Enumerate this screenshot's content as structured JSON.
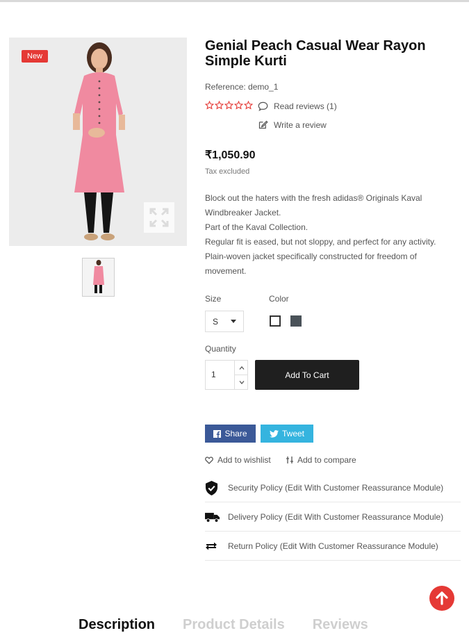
{
  "product": {
    "badge": "New",
    "title": "Genial Peach Casual Wear Rayon Simple Kurti",
    "reference": "Reference: demo_1",
    "rating_stars": 5,
    "read_reviews": "Read reviews (1)",
    "write_review": "Write a review",
    "price": "₹1,050.90",
    "tax_note": "Tax excluded",
    "description": [
      "Block out the haters with the fresh adidas® Originals Kaval Windbreaker Jacket.",
      "Part of the Kaval Collection.",
      "Regular fit is eased, but not sloppy, and perfect for any activity.",
      "Plain-woven jacket specifically constructed for freedom of movement."
    ]
  },
  "options": {
    "size_label": "Size",
    "size_value": "S",
    "color_label": "Color",
    "colors": [
      "#ffffff",
      "#4a5259"
    ]
  },
  "purchase": {
    "quantity_label": "Quantity",
    "quantity_value": "1",
    "add_to_cart": "Add To Cart"
  },
  "social": {
    "share": "Share",
    "tweet": "Tweet",
    "share_color": "#3b5998",
    "tweet_color": "#35b4df"
  },
  "actions": {
    "wishlist": "Add to wishlist",
    "compare": "Add to compare"
  },
  "reassurance": [
    {
      "icon": "shield-check-icon",
      "label": "Security Policy (Edit With Customer Reassurance Module)"
    },
    {
      "icon": "truck-icon",
      "label": "Delivery Policy (Edit With Customer Reassurance Module)"
    },
    {
      "icon": "exchange-arrows-icon",
      "label": "Return Policy (Edit With Customer Reassurance Module)"
    }
  ],
  "tabs": [
    "Description",
    "Product Details",
    "Reviews"
  ],
  "colors": {
    "accent": "#e53935",
    "button_dark": "#1f1f1f"
  }
}
